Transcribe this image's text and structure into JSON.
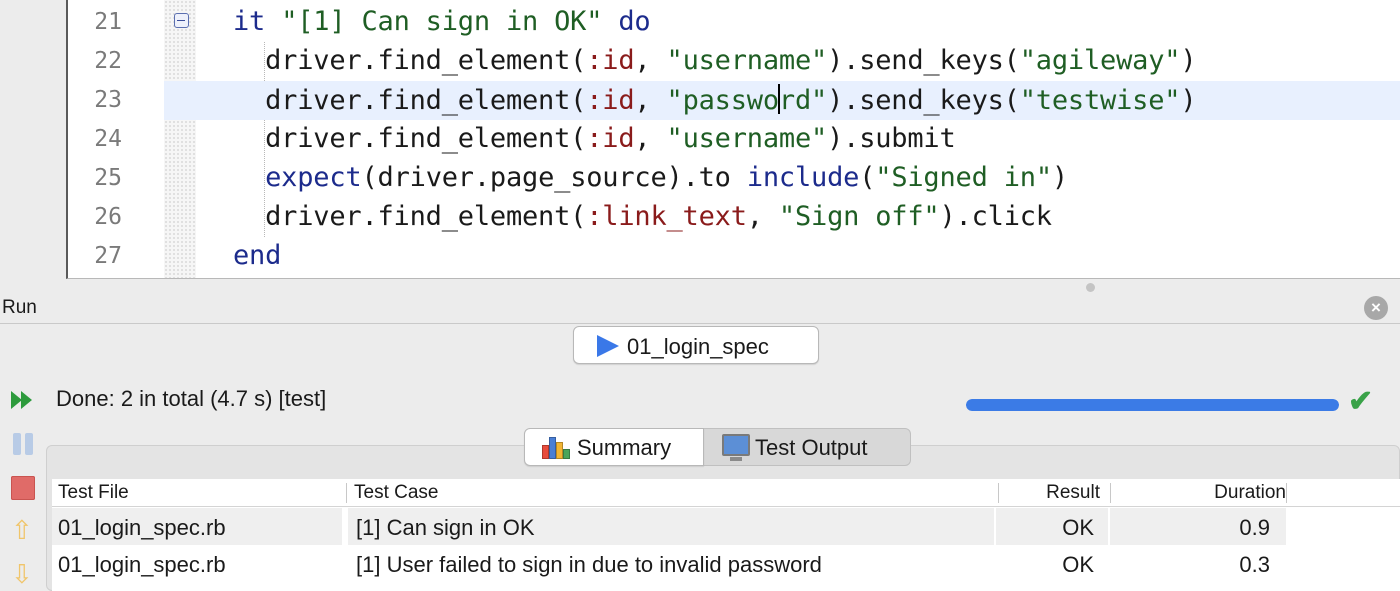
{
  "editor": {
    "lines": [
      {
        "no": "21",
        "foldable": true,
        "current": false,
        "tokens": [
          {
            "t": "it",
            "c": "kw"
          },
          {
            "t": " ",
            "c": ""
          },
          {
            "t": "\"[1] Can sign in OK\"",
            "c": "str"
          },
          {
            "t": " ",
            "c": ""
          },
          {
            "t": "do",
            "c": "kw"
          }
        ]
      },
      {
        "no": "22",
        "foldable": false,
        "current": false,
        "tokens": [
          {
            "t": "  driver.find_element(",
            "c": ""
          },
          {
            "t": ":id",
            "c": "sym"
          },
          {
            "t": ", ",
            "c": ""
          },
          {
            "t": "\"username\"",
            "c": "str"
          },
          {
            "t": ").send_keys(",
            "c": ""
          },
          {
            "t": "\"agileway\"",
            "c": "str"
          },
          {
            "t": ")",
            "c": ""
          }
        ]
      },
      {
        "no": "23",
        "foldable": false,
        "current": true,
        "tokens": [
          {
            "t": "  driver.find_element(",
            "c": ""
          },
          {
            "t": ":id",
            "c": "sym"
          },
          {
            "t": ", ",
            "c": ""
          },
          {
            "t": "\"passwo",
            "c": "str"
          },
          {
            "t": "|",
            "c": "caret"
          },
          {
            "t": "rd\"",
            "c": "str"
          },
          {
            "t": ").send_keys(",
            "c": ""
          },
          {
            "t": "\"testwise\"",
            "c": "str"
          },
          {
            "t": ")",
            "c": ""
          }
        ]
      },
      {
        "no": "24",
        "foldable": false,
        "current": false,
        "tokens": [
          {
            "t": "  driver.find_element(",
            "c": ""
          },
          {
            "t": ":id",
            "c": "sym"
          },
          {
            "t": ", ",
            "c": ""
          },
          {
            "t": "\"username\"",
            "c": "str"
          },
          {
            "t": ").submit",
            "c": ""
          }
        ]
      },
      {
        "no": "25",
        "foldable": false,
        "current": false,
        "tokens": [
          {
            "t": "  ",
            "c": ""
          },
          {
            "t": "expect",
            "c": "kw"
          },
          {
            "t": "(driver.page_source).to ",
            "c": ""
          },
          {
            "t": "include",
            "c": "kw"
          },
          {
            "t": "(",
            "c": ""
          },
          {
            "t": "\"Signed in\"",
            "c": "str"
          },
          {
            "t": ")",
            "c": ""
          }
        ]
      },
      {
        "no": "26",
        "foldable": false,
        "current": false,
        "tokens": [
          {
            "t": "  driver.find_element(",
            "c": ""
          },
          {
            "t": ":link_text",
            "c": "sym"
          },
          {
            "t": ", ",
            "c": ""
          },
          {
            "t": "\"Sign off\"",
            "c": "str"
          },
          {
            "t": ").click",
            "c": ""
          }
        ]
      },
      {
        "no": "27",
        "foldable": false,
        "current": false,
        "tokens": [
          {
            "t": "end",
            "c": "kw"
          }
        ]
      }
    ]
  },
  "run_panel": {
    "title": "Run",
    "tab_label": "01_login_spec",
    "status": "Done: 2 in total (4.7 s) [test]",
    "progress_percent": 100,
    "tabs": {
      "summary": "Summary",
      "output": "Test Output"
    },
    "columns": [
      "Test File",
      "Test Case",
      "Result",
      "Duration"
    ],
    "rows": [
      {
        "file": "01_login_spec.rb",
        "case": "[1] Can sign in OK",
        "result": "OK",
        "duration": "0.9"
      },
      {
        "file": "01_login_spec.rb",
        "case": "[1] User failed to sign in due to invalid password",
        "result": "OK",
        "duration": "0.3"
      }
    ]
  },
  "colors": {
    "accent": "#3b7be6",
    "pass": "#39a248",
    "keyword": "#1c2b8c",
    "string": "#1f5e24",
    "symbol": "#8a1b1b"
  },
  "icons": [
    "fold-minus-icon",
    "play-icon",
    "fast-forward-icon",
    "pause-icon",
    "stop-icon",
    "arrow-up-icon",
    "arrow-down-icon",
    "check-icon",
    "bar-chart-icon",
    "monitor-icon",
    "close-icon"
  ]
}
